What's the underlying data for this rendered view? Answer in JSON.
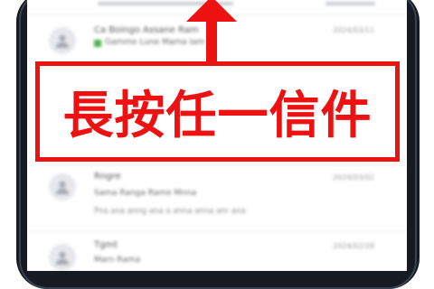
{
  "emails": [
    {
      "sender": "Ca Boingo Assane Ram",
      "subject": "Gamme Lune Mama Iam",
      "preview": "",
      "date": "2024/03/11"
    },
    {
      "sender": "Rngre",
      "subject": "Sama Ranga Rame Mnna",
      "preview": "Pna ana anng ana a anna anna anr ana",
      "date": "2024/03/02"
    },
    {
      "sender": "Tgmt",
      "subject": "Marn Rama",
      "preview": "",
      "date": "2024/02/28"
    }
  ],
  "callout": {
    "text": "長按任一信件"
  },
  "colors": {
    "accent": "#ee1111",
    "tag": "#4caf50",
    "frame": "#161a22"
  },
  "icons": {
    "avatar": "person-icon",
    "pointer": "arrow-up-icon"
  }
}
